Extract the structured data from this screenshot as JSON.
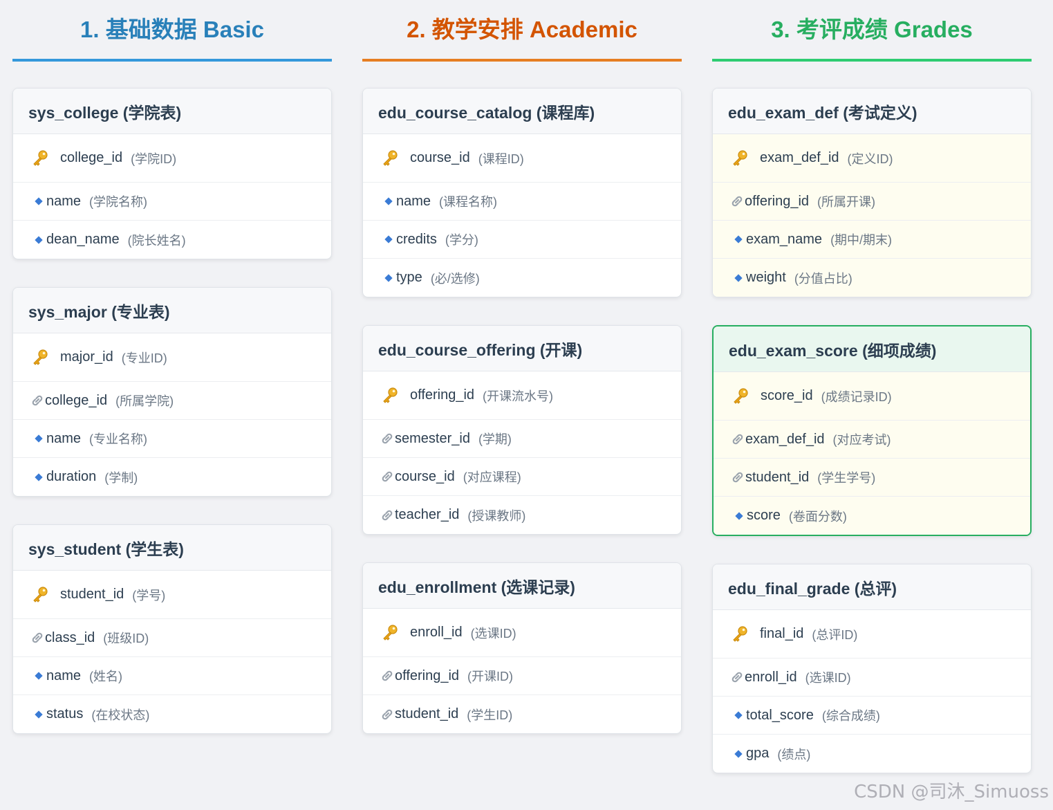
{
  "columns": [
    {
      "title": "1. 基础数据 Basic",
      "color": "#2980b9",
      "tables": [
        {
          "name": "sys_college (学院表)",
          "fields": [
            {
              "type": "pk",
              "name": "college_id",
              "desc": "(学院ID)"
            },
            {
              "type": "attr",
              "name": "name",
              "desc": "(学院名称)"
            },
            {
              "type": "attr",
              "name": "dean_name",
              "desc": "(院长姓名)"
            }
          ]
        },
        {
          "name": "sys_major (专业表)",
          "fields": [
            {
              "type": "pk",
              "name": "major_id",
              "desc": "(专业ID)"
            },
            {
              "type": "fk",
              "name": "college_id",
              "desc": "(所属学院)"
            },
            {
              "type": "attr",
              "name": "name",
              "desc": "(专业名称)"
            },
            {
              "type": "attr",
              "name": "duration",
              "desc": "(学制)"
            }
          ]
        },
        {
          "name": "sys_student (学生表)",
          "fields": [
            {
              "type": "pk",
              "name": "student_id",
              "desc": "(学号)"
            },
            {
              "type": "fk",
              "name": "class_id",
              "desc": "(班级ID)"
            },
            {
              "type": "attr",
              "name": "name",
              "desc": "(姓名)"
            },
            {
              "type": "attr",
              "name": "status",
              "desc": "(在校状态)"
            }
          ]
        }
      ]
    },
    {
      "title": "2. 教学安排 Academic",
      "color": "#d35400",
      "tables": [
        {
          "name": "edu_course_catalog (课程库)",
          "fields": [
            {
              "type": "pk",
              "name": "course_id",
              "desc": "(课程ID)"
            },
            {
              "type": "attr",
              "name": "name",
              "desc": "(课程名称)"
            },
            {
              "type": "attr",
              "name": "credits",
              "desc": "(学分)"
            },
            {
              "type": "attr",
              "name": "type",
              "desc": "(必/选修)"
            }
          ]
        },
        {
          "name": "edu_course_offering (开课)",
          "fields": [
            {
              "type": "pk",
              "name": "offering_id",
              "desc": "(开课流水号)"
            },
            {
              "type": "fk",
              "name": "semester_id",
              "desc": "(学期)"
            },
            {
              "type": "fk",
              "name": "course_id",
              "desc": "(对应课程)"
            },
            {
              "type": "fk",
              "name": "teacher_id",
              "desc": "(授课教师)"
            }
          ]
        },
        {
          "name": "edu_enrollment (选课记录)",
          "fields": [
            {
              "type": "pk",
              "name": "enroll_id",
              "desc": "(选课ID)"
            },
            {
              "type": "fk",
              "name": "offering_id",
              "desc": "(开课ID)"
            },
            {
              "type": "fk",
              "name": "student_id",
              "desc": "(学生ID)"
            }
          ]
        }
      ]
    },
    {
      "title": "3. 考评成绩 Grades",
      "color": "#27ae60",
      "tables": [
        {
          "name": "edu_exam_def (考试定义)",
          "style": "yellow",
          "fields": [
            {
              "type": "pk",
              "name": "exam_def_id",
              "desc": "(定义ID)"
            },
            {
              "type": "fk",
              "name": "offering_id",
              "desc": "(所属开课)"
            },
            {
              "type": "attr",
              "name": "exam_name",
              "desc": "(期中/期末)"
            },
            {
              "type": "attr",
              "name": "weight",
              "desc": "(分值占比)"
            }
          ]
        },
        {
          "name": "edu_exam_score (细项成绩)",
          "style": "highlight yellow",
          "fields": [
            {
              "type": "pk",
              "name": "score_id",
              "desc": "(成绩记录ID)"
            },
            {
              "type": "fk",
              "name": "exam_def_id",
              "desc": "(对应考试)"
            },
            {
              "type": "fk",
              "name": "student_id",
              "desc": "(学生学号)"
            },
            {
              "type": "attr",
              "name": "score",
              "desc": "(卷面分数)"
            }
          ]
        },
        {
          "name": "edu_final_grade (总评)",
          "fields": [
            {
              "type": "pk",
              "name": "final_id",
              "desc": "(总评ID)"
            },
            {
              "type": "fk",
              "name": "enroll_id",
              "desc": "(选课ID)"
            },
            {
              "type": "attr",
              "name": "total_score",
              "desc": "(综合成绩)"
            },
            {
              "type": "attr",
              "name": "gpa",
              "desc": "(绩点)"
            }
          ]
        }
      ]
    }
  ],
  "watermark": "CSDN @司沐_Simuoss",
  "icons": {
    "pk": "key-icon",
    "fk": "link-icon",
    "attr": "diamond-bullet-icon"
  }
}
